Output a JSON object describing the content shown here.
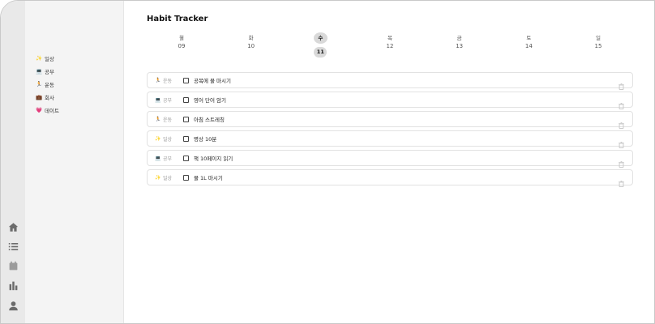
{
  "app": {
    "title": "Habit Tracker"
  },
  "rail": {
    "items": [
      {
        "icon": "home-icon"
      },
      {
        "icon": "list-icon"
      },
      {
        "icon": "calendar-icon"
      },
      {
        "icon": "bar-chart-icon"
      },
      {
        "icon": "user-icon"
      }
    ]
  },
  "sidebar": {
    "categories": [
      {
        "emoji": "✨",
        "label": "일상"
      },
      {
        "emoji": "💻",
        "label": "공부"
      },
      {
        "emoji": "🏃",
        "label": "운동"
      },
      {
        "emoji": "💼",
        "label": "회사"
      },
      {
        "emoji": "💗",
        "label": "데이트"
      }
    ]
  },
  "week": {
    "selected_index": 2,
    "days": [
      {
        "dow": "월",
        "date": "09"
      },
      {
        "dow": "화",
        "date": "10"
      },
      {
        "dow": "수",
        "date": "11"
      },
      {
        "dow": "목",
        "date": "12"
      },
      {
        "dow": "금",
        "date": "13"
      },
      {
        "dow": "토",
        "date": "14"
      },
      {
        "dow": "일",
        "date": "15"
      }
    ]
  },
  "habits": [
    {
      "category_emoji": "🏃",
      "category": "운동",
      "name": "공복에 물 마시기"
    },
    {
      "category_emoji": "💻",
      "category": "공부",
      "name": "영어 단어 암기"
    },
    {
      "category_emoji": "🏃",
      "category": "운동",
      "name": "아침 스트레칭"
    },
    {
      "category_emoji": "✨",
      "category": "일상",
      "name": "명상 10분"
    },
    {
      "category_emoji": "💻",
      "category": "공부",
      "name": "책 10페이지 읽기"
    },
    {
      "category_emoji": "✨",
      "category": "일상",
      "name": "물 1L 마시기"
    }
  ],
  "colors": {
    "rail_bg": "#e9e9e9",
    "sidebar_bg": "#f4f4f4",
    "selected_day_bg": "#d9d9d9",
    "card_border": "#e2e2e2"
  }
}
